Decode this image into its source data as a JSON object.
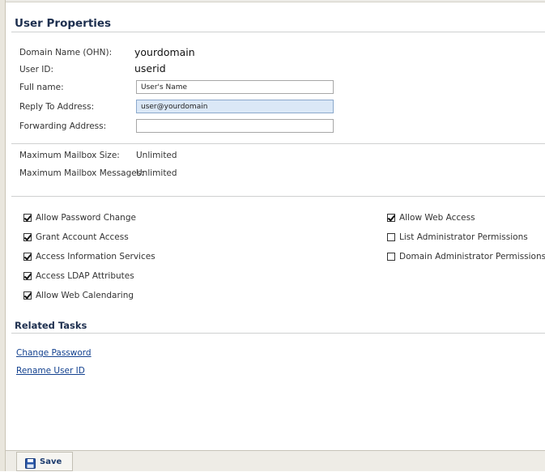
{
  "header": {
    "title": "User Properties"
  },
  "fields": {
    "domain_label": "Domain Name (OHN):",
    "domain_value": "yourdomain",
    "userid_label": "User ID:",
    "userid_value": "userid",
    "fullname_label": "Full name:",
    "fullname_value": "User's Name",
    "reply_label": "Reply To Address:",
    "reply_value": "user@yourdomain",
    "forward_label": "Forwarding Address:",
    "forward_value": ""
  },
  "mailbox": {
    "size_label": "Maximum Mailbox Size:",
    "size_value": "Unlimited",
    "messages_label": "Maximum Mailbox Messages:",
    "messages_value": "Unlimited"
  },
  "permissions": {
    "left": [
      {
        "label": "Allow Password Change",
        "checked": true
      },
      {
        "label": "Grant Account Access",
        "checked": true
      },
      {
        "label": "Access Information Services",
        "checked": true
      },
      {
        "label": "Access LDAP Attributes",
        "checked": true
      },
      {
        "label": "Allow Web Calendaring",
        "checked": true
      }
    ],
    "right": [
      {
        "label": "Allow Web Access",
        "checked": true
      },
      {
        "label": "List Administrator Permissions",
        "checked": false
      },
      {
        "label": "Domain Administrator Permissions",
        "checked": false
      }
    ]
  },
  "related": {
    "title": "Related Tasks",
    "links": [
      {
        "label": "Change Password"
      },
      {
        "label": "Rename User ID"
      }
    ]
  },
  "toolbar": {
    "save_label": "Save",
    "save_icon": "floppy-disk-icon"
  },
  "colors": {
    "heading": "#1d2f4f",
    "link": "#13418f",
    "focused_field": "#dbe8f7",
    "save_icon": "#2a57a8"
  }
}
